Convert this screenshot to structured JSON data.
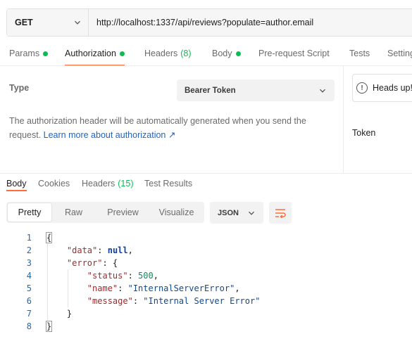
{
  "request": {
    "method": "GET",
    "url": "http://localhost:1337/api/reviews?populate=author.email"
  },
  "request_tabs": [
    {
      "label": "Params",
      "dot": true,
      "count": "",
      "active": false
    },
    {
      "label": "Authorization",
      "dot": true,
      "count": "",
      "active": true
    },
    {
      "label": "Headers",
      "dot": false,
      "count": "(8)",
      "active": false
    },
    {
      "label": "Body",
      "dot": true,
      "count": "",
      "active": false
    },
    {
      "label": "Pre-request Script",
      "dot": false,
      "count": "",
      "active": false
    },
    {
      "label": "Tests",
      "dot": false,
      "count": "",
      "active": false
    },
    {
      "label": "Settings",
      "dot": false,
      "count": "",
      "active": false
    }
  ],
  "auth": {
    "type_label": "Type",
    "type_value": "Bearer Token",
    "description": "The authorization header will be automatically generated when you send the request.",
    "learn_more": "Learn more about authorization ↗",
    "heads_up": "Heads up!",
    "token_label": "Token"
  },
  "response_tabs": [
    {
      "label": "Body",
      "count": "",
      "active": true
    },
    {
      "label": "Cookies",
      "count": "",
      "active": false
    },
    {
      "label": "Headers",
      "count": "(15)",
      "active": false
    },
    {
      "label": "Test Results",
      "count": "",
      "active": false
    }
  ],
  "view_modes": [
    "Pretty",
    "Raw",
    "Preview",
    "Visualize"
  ],
  "active_view": "Pretty",
  "format": "JSON",
  "icons": {
    "method_dropdown": "chevron-down-icon",
    "auth_dropdown": "chevron-down-icon",
    "format_dropdown": "chevron-down-icon",
    "heads_up": "info-icon",
    "wrap": "wrap-lines-icon"
  },
  "colors": {
    "accent": "#ff6c37",
    "status_dot": "#0cbb52",
    "link": "#1e63c4"
  },
  "code_lines": [
    {
      "n": "1",
      "parts": [
        [
          "pun",
          "{"
        ]
      ]
    },
    {
      "n": "2",
      "parts": [
        [
          "pun",
          "    "
        ],
        [
          "key",
          "\"data\""
        ],
        [
          "pun",
          ": "
        ],
        [
          "lit",
          "null"
        ],
        [
          "pun",
          ","
        ]
      ]
    },
    {
      "n": "3",
      "parts": [
        [
          "pun",
          "    "
        ],
        [
          "key",
          "\"error\""
        ],
        [
          "pun",
          ": {"
        ]
      ]
    },
    {
      "n": "4",
      "parts": [
        [
          "pun",
          "        "
        ],
        [
          "key",
          "\"status\""
        ],
        [
          "pun",
          ": "
        ],
        [
          "num",
          "500"
        ],
        [
          "pun",
          ","
        ]
      ]
    },
    {
      "n": "5",
      "parts": [
        [
          "pun",
          "        "
        ],
        [
          "key",
          "\"name\""
        ],
        [
          "pun",
          ": "
        ],
        [
          "str",
          "\"InternalServerError\""
        ],
        [
          "pun",
          ","
        ]
      ]
    },
    {
      "n": "6",
      "parts": [
        [
          "pun",
          "        "
        ],
        [
          "key",
          "\"message\""
        ],
        [
          "pun",
          ": "
        ],
        [
          "str",
          "\"Internal Server Error\""
        ]
      ]
    },
    {
      "n": "7",
      "parts": [
        [
          "pun",
          "    }"
        ]
      ]
    },
    {
      "n": "8",
      "parts": [
        [
          "pun",
          "}"
        ]
      ]
    }
  ]
}
